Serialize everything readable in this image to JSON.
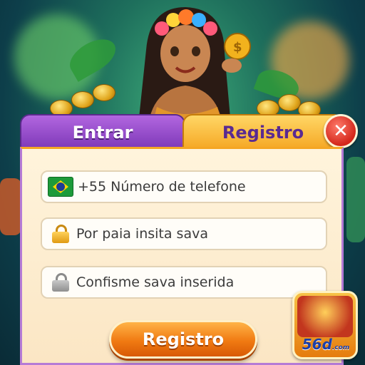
{
  "tabs": {
    "login_label": "Entrar",
    "register_label": "Registro",
    "active": "register"
  },
  "form": {
    "phone": {
      "prefix": "+55",
      "placeholder": "Número de telefone",
      "country_icon": "brazil-flag-icon"
    },
    "password": {
      "placeholder": "Por paia insita sava",
      "icon": "lock-icon"
    },
    "confirm_password": {
      "placeholder": "Confisme sava inserida",
      "icon": "lock-icon"
    },
    "submit_label": "Registro"
  },
  "logo": {
    "text_main": "56d",
    "text_sub": ".com"
  },
  "colors": {
    "login_tab": "#8b3fc4",
    "register_tab": "#f5a623",
    "submit": "#f07a12",
    "close": "#d3261a"
  }
}
